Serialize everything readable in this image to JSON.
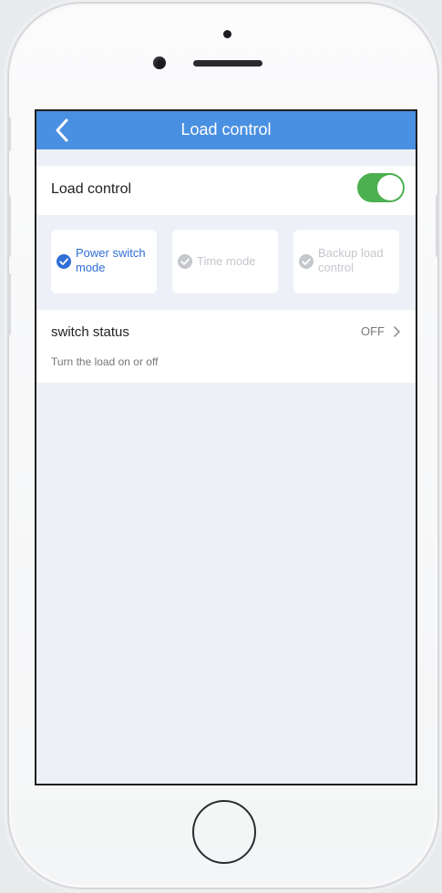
{
  "navbar": {
    "title": "Load control",
    "back_icon": "chevron-left-icon",
    "color": "#4a90e2"
  },
  "load_control": {
    "label": "Load control",
    "toggle_on": true,
    "toggle_color": "#4caf50"
  },
  "modes": [
    {
      "label": "Power switch mode",
      "selected": true
    },
    {
      "label": "Time mode",
      "selected": false
    },
    {
      "label": "Backup load control",
      "selected": false
    }
  ],
  "switch_status": {
    "title": "switch status",
    "value": "OFF",
    "description": "Turn the load on or off"
  },
  "colors": {
    "accent": "#2f6fd6",
    "muted": "#c4c7cc",
    "background": "#edf0f6"
  }
}
